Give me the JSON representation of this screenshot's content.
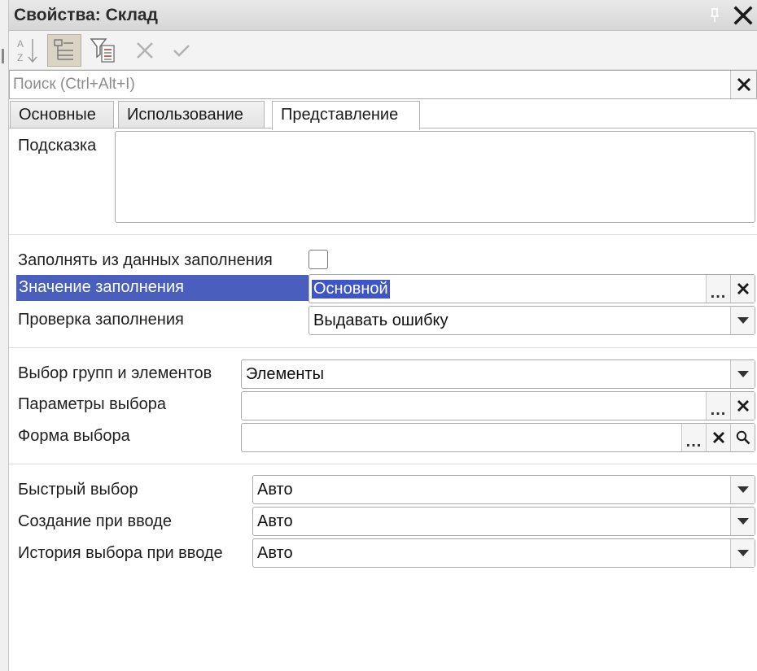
{
  "window": {
    "title": "Свойства: Склад"
  },
  "search": {
    "placeholder": "Поиск (Ctrl+Alt+I)"
  },
  "tabs": [
    {
      "label": "Основные"
    },
    {
      "label": "Использование"
    },
    {
      "label": "Представление",
      "active": true
    }
  ],
  "fields": {
    "hint": {
      "label": "Подсказка",
      "value": ""
    },
    "fill_from_data": {
      "label": "Заполнять из данных заполнения",
      "checked": false
    },
    "fill_value": {
      "label": "Значение заполнения",
      "value": "Основной"
    },
    "fill_check": {
      "label": "Проверка заполнения",
      "value": "Выдавать ошибку"
    },
    "group_selection": {
      "label": "Выбор групп и элементов",
      "value": "Элементы"
    },
    "selection_params": {
      "label": "Параметры выбора",
      "value": ""
    },
    "selection_form": {
      "label": "Форма выбора",
      "value": ""
    },
    "quick_choice": {
      "label": "Быстрый выбор",
      "value": "Авто"
    },
    "create_on_input": {
      "label": "Создание при вводе",
      "value": "Авто"
    },
    "choice_history": {
      "label": "История выбора при вводе",
      "value": "Авто"
    }
  },
  "colors": {
    "highlight": "#4a5fbd",
    "selection": "#3d55c9",
    "titlebar": "#dedede"
  }
}
